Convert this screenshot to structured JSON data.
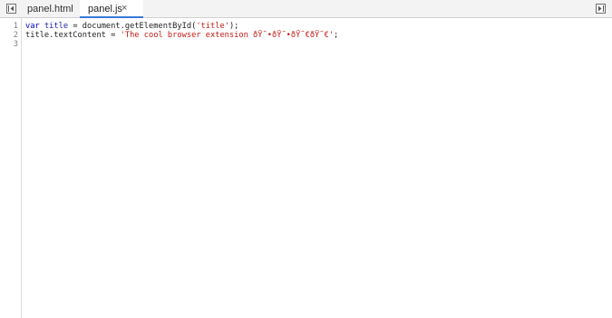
{
  "tabs": [
    {
      "label": "panel.html",
      "active": false
    },
    {
      "label": "panel.js",
      "active": true,
      "close": "×"
    }
  ],
  "gutter": {
    "line_numbers": [
      "1",
      "2",
      "3"
    ]
  },
  "code": {
    "line1": {
      "keyword": "var",
      "space1": " ",
      "variable": "title",
      "rest": " = document.getElementById(",
      "string": "'title'",
      "end": ");"
    },
    "line2": {
      "rest": "title.textContent = ",
      "string": "'The cool browser extension ðŸ˜•ðŸ˜•ðŸ˜€ðŸ˜€'",
      "end": ";"
    },
    "line3": ""
  },
  "colors": {
    "keyword": "#0000cc",
    "string": "#c41a16",
    "active_tab_underline": "#3879d9"
  },
  "icons": {
    "left_toggle": "toggle-sidebar-left-icon",
    "right_toggle": "toggle-sidebar-right-icon"
  }
}
